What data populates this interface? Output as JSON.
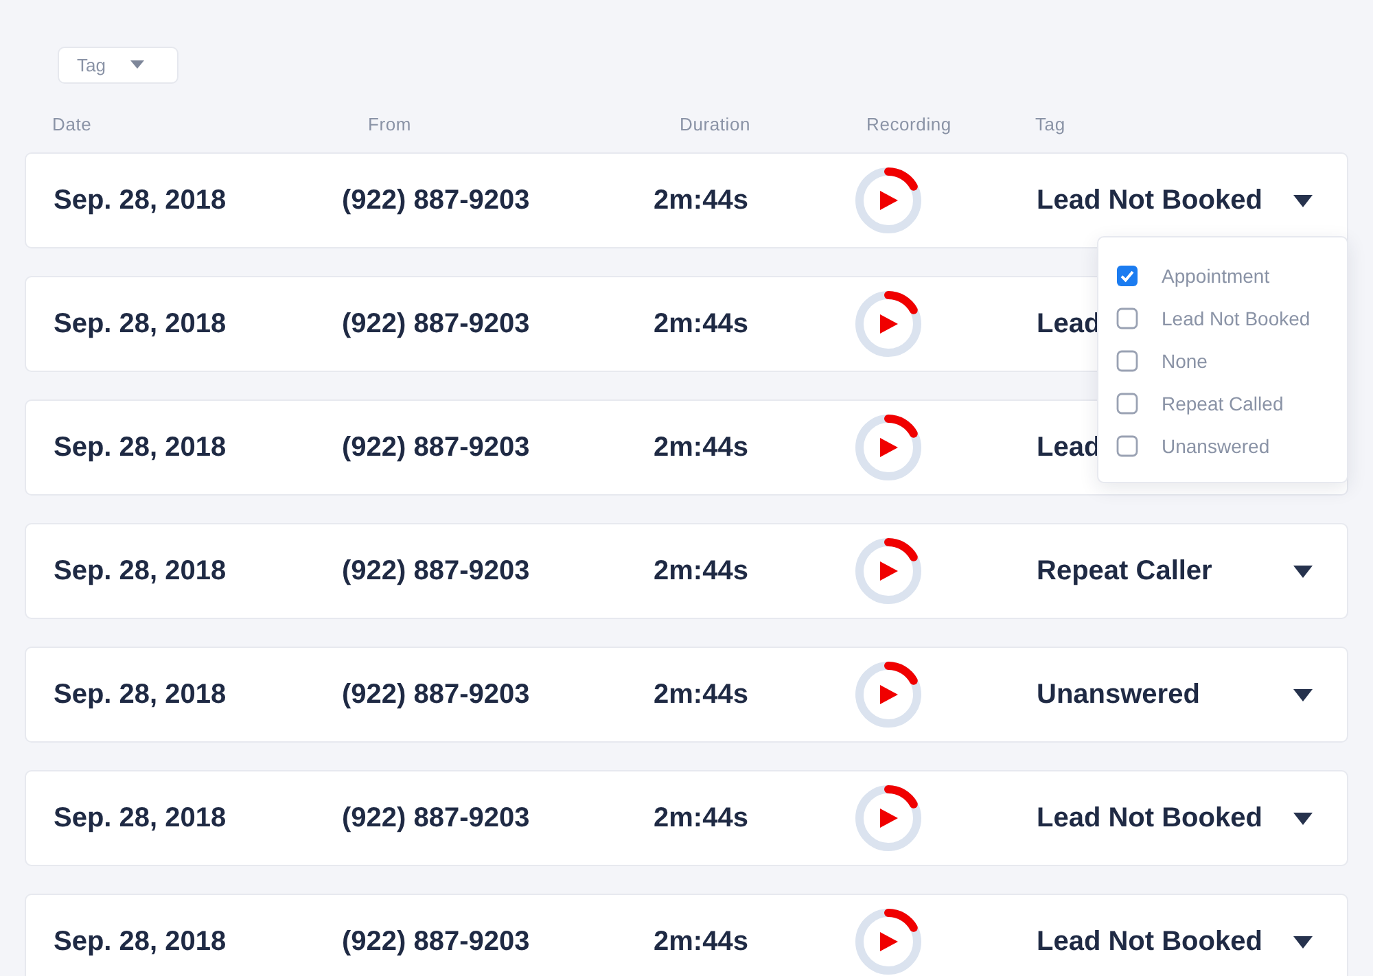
{
  "filter": {
    "label": "Tag"
  },
  "columns": [
    "Date",
    "From",
    "Duration",
    "Recording",
    "Tag"
  ],
  "rows": [
    {
      "date": "Sep. 28, 2018",
      "from": "(922) 887-9203",
      "duration": "2m:44s",
      "tag": "Lead Not Booked",
      "caret": true
    },
    {
      "date": "Sep. 28, 2018",
      "from": "(922) 887-9203",
      "duration": "2m:44s",
      "tag": "Lead",
      "caret": false
    },
    {
      "date": "Sep. 28, 2018",
      "from": "(922) 887-9203",
      "duration": "2m:44s",
      "tag": "Lead",
      "caret": false
    },
    {
      "date": "Sep. 28, 2018",
      "from": "(922) 887-9203",
      "duration": "2m:44s",
      "tag": "Repeat Caller",
      "caret": true
    },
    {
      "date": "Sep. 28, 2018",
      "from": "(922) 887-9203",
      "duration": "2m:44s",
      "tag": "Unanswered",
      "caret": true
    },
    {
      "date": "Sep. 28, 2018",
      "from": "(922) 887-9203",
      "duration": "2m:44s",
      "tag": "Lead Not Booked",
      "caret": true
    },
    {
      "date": "Sep. 28, 2018",
      "from": "(922) 887-9203",
      "duration": "2m:44s",
      "tag": "Lead Not Booked",
      "caret": true
    }
  ],
  "tag_menu": [
    {
      "label": "Appointment",
      "checked": true
    },
    {
      "label": "Lead Not Booked",
      "checked": false
    },
    {
      "label": "None",
      "checked": false
    },
    {
      "label": "Repeat Called",
      "checked": false
    },
    {
      "label": "Unanswered",
      "checked": false
    }
  ]
}
